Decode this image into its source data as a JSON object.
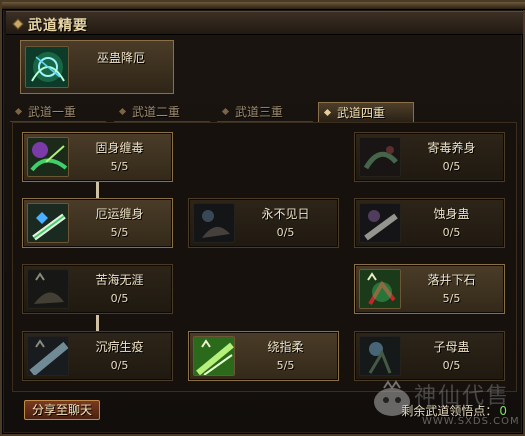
{
  "window": {
    "title": "武道精要"
  },
  "featured_skill": {
    "name": "巫蛊降厄",
    "icon": "wugu-jiang-e-icon"
  },
  "tabs": [
    {
      "label": "武道一重",
      "active": false
    },
    {
      "label": "武道二重",
      "active": false
    },
    {
      "label": "武道三重",
      "active": false
    },
    {
      "label": "武道四重",
      "active": true
    }
  ],
  "skills": [
    {
      "name": "固身缠毒",
      "level": "5/5",
      "icon": "gushen-chandu-icon"
    },
    {
      "name": "寄毒养身",
      "level": "0/5",
      "icon": "jidu-yangshen-icon"
    },
    {
      "name": "厄运缠身",
      "level": "5/5",
      "icon": "eyun-chanshen-icon"
    },
    {
      "name": "永不见日",
      "level": "0/5",
      "icon": "yongbu-jianri-icon"
    },
    {
      "name": "蚀身蛊",
      "level": "0/5",
      "icon": "shishen-gu-icon"
    },
    {
      "name": "苦海无涯",
      "level": "0/5",
      "icon": "kuhai-wuya-icon"
    },
    {
      "name": "落井下石",
      "level": "5/5",
      "icon": "luojing-xiashi-icon"
    },
    {
      "name": "沉疴生疫",
      "level": "0/5",
      "icon": "chenke-shengyi-icon"
    },
    {
      "name": "绕指柔",
      "level": "5/5",
      "icon": "raozhirou-icon"
    },
    {
      "name": "子母蛊",
      "level": "0/5",
      "icon": "zimu-gu-icon"
    }
  ],
  "footer": {
    "share_label": "分享至聊天",
    "points_label": "剩余武道领悟点：",
    "points_value": "0"
  },
  "watermark": {
    "text": "神仙代售",
    "url": "WWW.SXDS.COM"
  }
}
